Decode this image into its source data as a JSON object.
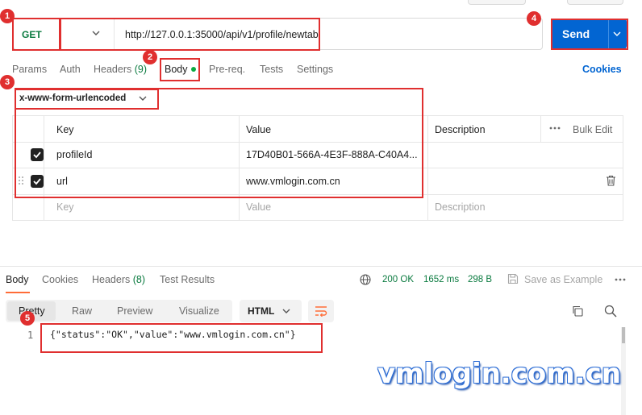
{
  "request": {
    "method": "GET",
    "url": "http://127.0.0.1:35000/api/v1/profile/newtab",
    "send_label": "Send"
  },
  "tabs": {
    "params": "Params",
    "auth": "Auth",
    "headers": "Headers",
    "headers_count": "(9)",
    "body": "Body",
    "prereq": "Pre-req.",
    "tests": "Tests",
    "settings": "Settings",
    "cookies": "Cookies"
  },
  "body_type": "x-www-form-urlencoded",
  "table": {
    "headers": {
      "key": "Key",
      "value": "Value",
      "description": "Description",
      "bulk_edit": "Bulk Edit"
    },
    "rows": [
      {
        "key": "profileId",
        "value": "17D40B01-566A-4E3F-888A-C40A4...",
        "checked": true
      },
      {
        "key": "url",
        "value": "www.vmlogin.com.cn",
        "checked": true
      }
    ],
    "placeholder": {
      "key": "Key",
      "value": "Value",
      "description": "Description"
    }
  },
  "response": {
    "tabs": {
      "body": "Body",
      "cookies": "Cookies",
      "headers": "Headers",
      "headers_count": "(8)",
      "test_results": "Test Results"
    },
    "status": "200 OK",
    "time": "1652 ms",
    "size": "298 B",
    "save_as_example": "Save as Example",
    "views": {
      "pretty": "Pretty",
      "raw": "Raw",
      "preview": "Preview",
      "visualize": "Visualize"
    },
    "format": "HTML",
    "line_number": "1",
    "code": "{\"status\":\"OK\",\"value\":\"www.vmlogin.com.cn\"}"
  },
  "annotations": [
    "1",
    "2",
    "3",
    "4",
    "5"
  ],
  "watermark": "vmlogin.com.cn",
  "colors": {
    "accent": "#0265d2",
    "highlight": "#e02f2f",
    "status_ok": "#0a7a3f",
    "tab_indicator": "#ff6c37"
  }
}
